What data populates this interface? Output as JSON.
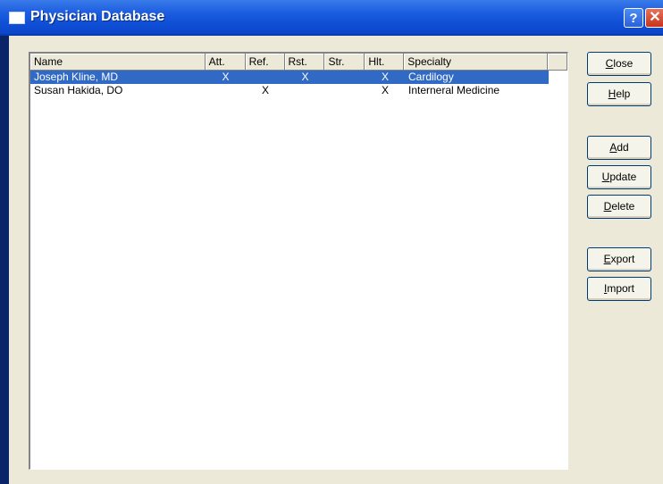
{
  "window": {
    "title": "Physician Database",
    "help_glyph": "?",
    "close_glyph": "✕"
  },
  "list": {
    "columns": [
      "Name",
      "Att.",
      "Ref.",
      "Rst.",
      "Str.",
      "Hlt.",
      "Specialty"
    ],
    "rows": [
      {
        "name": "Joseph  Kline, MD",
        "att": "X",
        "ref": "",
        "rst": "X",
        "str": "",
        "hlt": "X",
        "specialty": "Cardilogy",
        "selected": true
      },
      {
        "name": "Susan  Hakida, DO",
        "att": "",
        "ref": "X",
        "rst": "",
        "str": "",
        "hlt": "X",
        "specialty": "Interneral Medicine",
        "selected": false
      }
    ]
  },
  "buttons": {
    "close": {
      "hotkey": "C",
      "rest": "lose"
    },
    "help": {
      "hotkey": "H",
      "rest": "elp"
    },
    "add": {
      "hotkey": "A",
      "rest": "dd"
    },
    "update": {
      "hotkey": "U",
      "rest": "pdate"
    },
    "delete": {
      "hotkey": "D",
      "rest": "elete"
    },
    "export": {
      "hotkey": "E",
      "rest": "xport"
    },
    "import": {
      "hotkey": "I",
      "rest": "mport"
    }
  },
  "colors": {
    "titlebar": "#0f4fd6",
    "selection": "#316ac5",
    "dialog_bg": "#ece9d8"
  }
}
